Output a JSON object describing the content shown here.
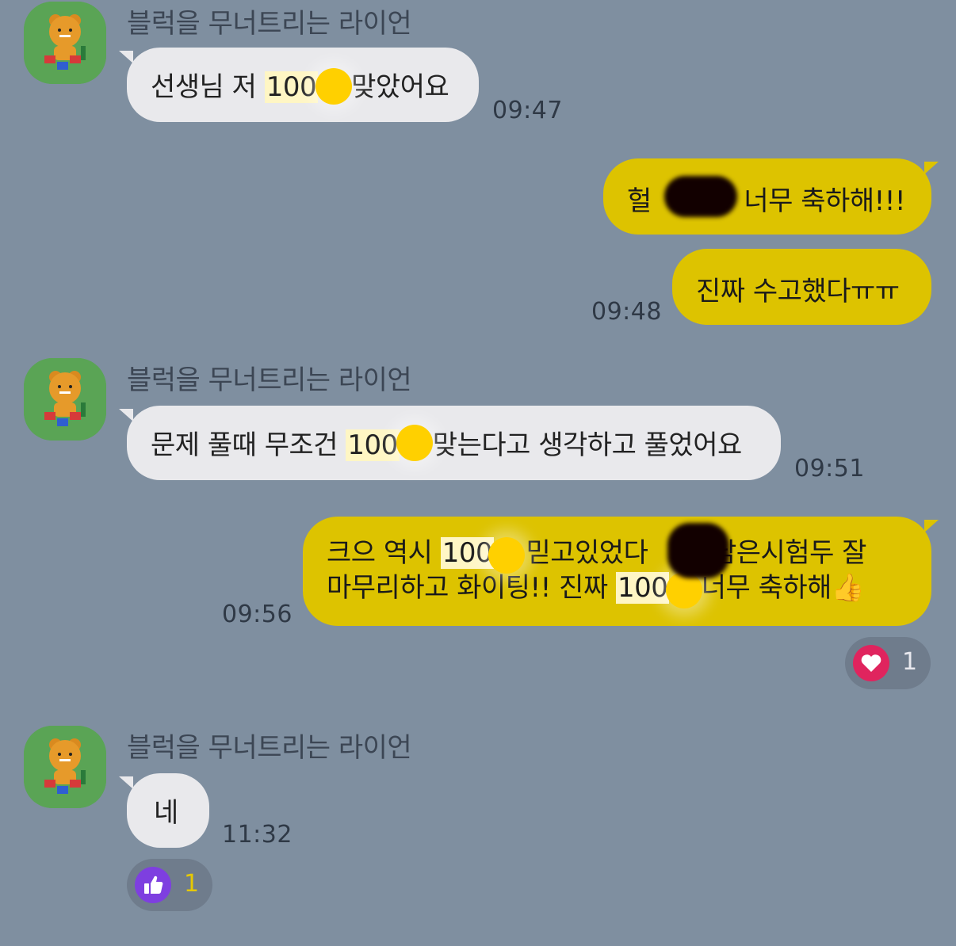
{
  "chat": {
    "sender_name": "블럭을 무너트리는 라이언",
    "messages": [
      {
        "pre": "선생님 저 ",
        "hl": "100",
        "post": "맞았어요",
        "time": "09:47"
      },
      {
        "text1": "헐 ",
        "text2": " 너무 축하해!!!"
      },
      {
        "text": "진짜 수고했다ㅠㅠ",
        "time": "09:48"
      },
      {
        "pre": "문제 풀때 무조건 ",
        "hl": "100",
        "post": "맞는다고 생각하고 풀었어요",
        "time": "09:51"
      },
      {
        "l1a": "크으 역시 ",
        "l1hl": "100",
        "l1b": " 믿고있었다 ",
        "l1c": " 남은시험두 잘",
        "l2a": "마무리하고 화이팅!! 진짜 ",
        "l2hl": "100",
        "l2b": " 너무 축하해",
        "emoji": "👍",
        "time": "09:56"
      },
      {
        "text": "네",
        "time": "11:32"
      }
    ],
    "reactions": {
      "heart_count": "1",
      "like_count": "1"
    }
  },
  "colors": {
    "background": "#7f8fa0",
    "incoming_bubble": "#e9e9ec",
    "outgoing_bubble": "#ddc300",
    "heart": "#e0245e",
    "like": "#7e3fe0"
  }
}
